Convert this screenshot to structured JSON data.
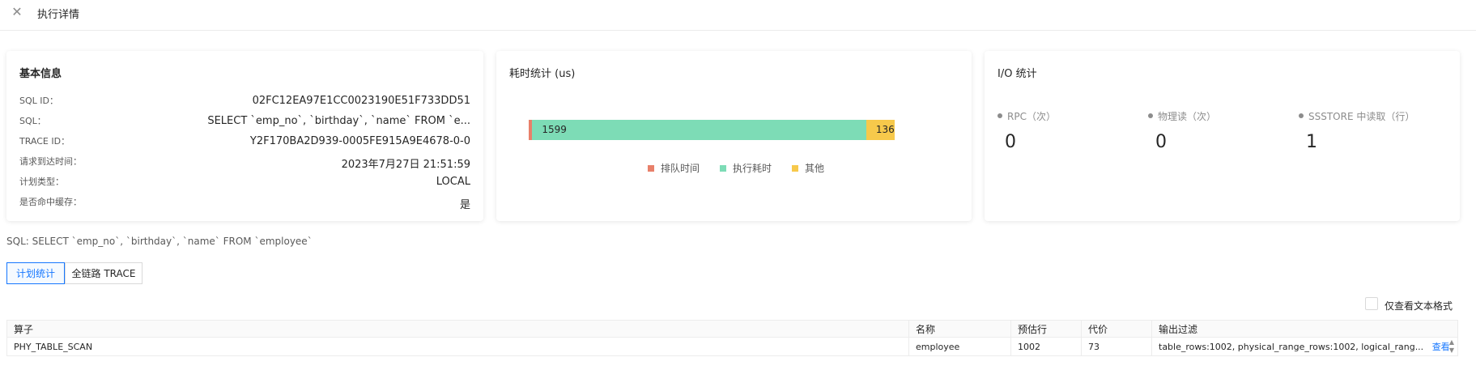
{
  "header": {
    "title": "执行详情",
    "close_icon": "close-icon"
  },
  "basic_info": {
    "title": "基本信息",
    "rows": [
      {
        "label": "SQL ID：",
        "value": "02FC12EA97E1CC0023190E51F733DD51"
      },
      {
        "label": "SQL：",
        "value": "SELECT `emp_no`, `birthday`, `name` FROM `e..."
      },
      {
        "label": "TRACE ID：",
        "value": "Y2F170BA2D939-0005FE915A9E4678-0-0"
      },
      {
        "label": "请求到达时间：",
        "value": "2023年7月27日 21:51:59"
      },
      {
        "label": "计划类型：",
        "value": "LOCAL"
      },
      {
        "label": "是否命中缓存：",
        "value": "是"
      }
    ]
  },
  "time_stats": {
    "title": "耗时统计 (us)",
    "segments": [
      {
        "name": "排队时间",
        "value": 17,
        "color": "#e8806a",
        "label": ""
      },
      {
        "name": "执行耗时",
        "value": 1599,
        "color": "#7ddcb6",
        "label": "1599"
      },
      {
        "name": "其他",
        "value": 136,
        "color": "#f7c94b",
        "label": "136"
      }
    ]
  },
  "io_stats": {
    "title": "I/O 统计",
    "items": [
      {
        "label": "RPC（次）",
        "value": "0"
      },
      {
        "label": "物理读（次）",
        "value": "0"
      },
      {
        "label": "SSSTORE 中读取（行）",
        "value": "1"
      }
    ]
  },
  "sql_line": "SQL: SELECT `emp_no`, `birthday`, `name` FROM `employee`",
  "tabs": [
    {
      "label": "计划统计",
      "active": true
    },
    {
      "label": "全链路 TRACE",
      "active": false
    }
  ],
  "text_format_checkbox": {
    "label": "仅查看文本格式",
    "checked": false
  },
  "plan_table": {
    "columns": [
      "算子",
      "名称",
      "预估行",
      "代价",
      "输出过滤"
    ],
    "rows": [
      {
        "operator": "PHY_TABLE_SCAN",
        "name": "employee",
        "est_rows": "1002",
        "cost": "73",
        "output_filter": "table_rows:1002, physical_range_rows:1002, logical_rang...",
        "link": "查看"
      }
    ]
  }
}
